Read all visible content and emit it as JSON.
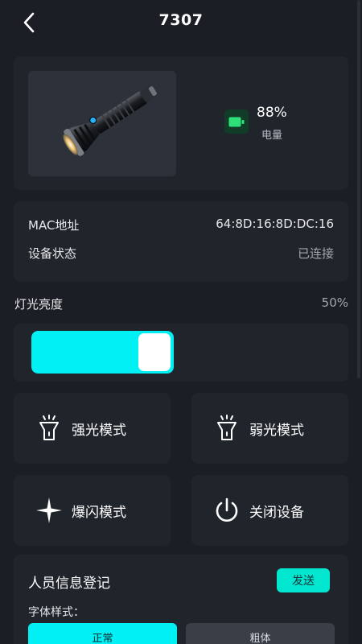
{
  "header": {
    "title": "7307"
  },
  "device": {
    "battery_percent": "88%",
    "battery_label": "电量",
    "battery_color": "#2ee07a"
  },
  "info": {
    "mac_label": "MAC地址",
    "mac_value": "64:8D:16:8D:DC:16",
    "status_label": "设备状态",
    "status_value": "已连接"
  },
  "brightness": {
    "label": "灯光亮度",
    "value_text": "50%",
    "level": 0.5
  },
  "modes": {
    "strong": {
      "label": "强光模式",
      "icon": "flashlight-icon"
    },
    "weak": {
      "label": "弱光模式",
      "icon": "flashlight-icon"
    },
    "flash": {
      "label": "爆闪模式",
      "icon": "sparkle-icon"
    },
    "power": {
      "label": "关闭设备",
      "icon": "power-icon"
    }
  },
  "registration": {
    "title": "人员信息登记",
    "send_label": "发送",
    "font_style_label": "字体样式：",
    "options": [
      "正常",
      "粗体"
    ]
  },
  "colors": {
    "accent": "#00f0f4",
    "send": "#00e6cf",
    "background": "#1b1e24",
    "card": "#20242b"
  }
}
